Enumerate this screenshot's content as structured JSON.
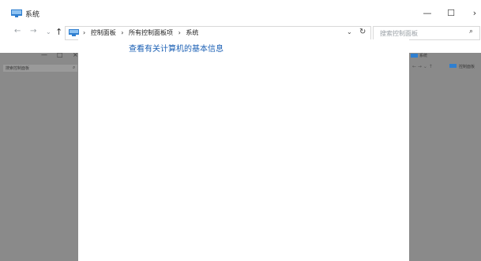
{
  "window": {
    "title": "系统",
    "minimize_glyph": "—",
    "maximize_glyph": "☐",
    "close_glyph": "›"
  },
  "nav": {
    "back_glyph": "←",
    "forward_glyph": "→",
    "recent_glyph": "⌄",
    "up_glyph": "↑"
  },
  "address": {
    "breadcrumbs": [
      "控制面板",
      "所有控制面板项",
      "系统"
    ],
    "separator": "›",
    "dropdown_glyph": "⌄",
    "refresh_glyph": "↻"
  },
  "search": {
    "placeholder": "搜索控制面板",
    "icon": "search-icon",
    "glyph": "⌕"
  },
  "main": {
    "heading": "查看有关计算机的基本信息"
  },
  "left_panel": {
    "min_glyph": "—",
    "max_glyph": "□",
    "close_glyph": "×",
    "search_placeholder": "搜索控制面板",
    "search_glyph": "⌕"
  },
  "right_panel": {
    "title": "系统",
    "crumb": "控制面板"
  },
  "colors": {
    "accent": "#1a5fb4",
    "gray": "#8a8a8a",
    "icon_blue": "#2f7fd0"
  }
}
